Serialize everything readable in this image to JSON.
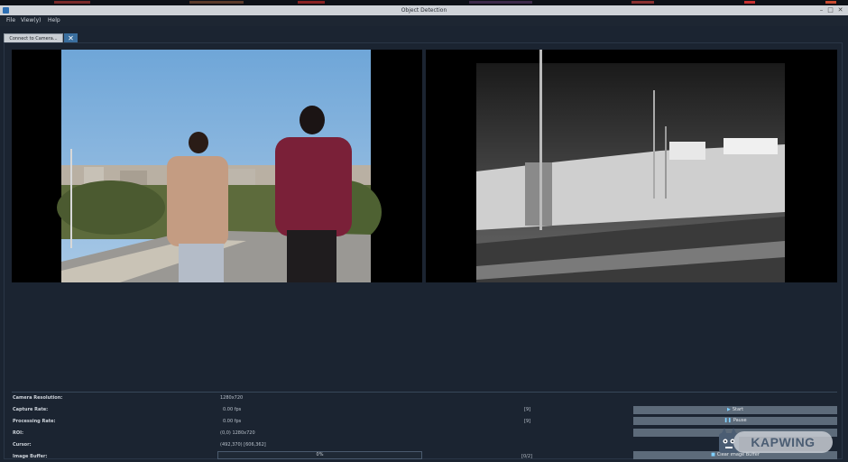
{
  "window": {
    "title": "Object Detection"
  },
  "menu": {
    "items": [
      "File",
      "View(y)",
      "Help"
    ]
  },
  "tab": {
    "label": "Connect to Camera...",
    "close_symbol": "✕"
  },
  "stats": {
    "camera_resolution": {
      "label": "Camera Resolution:",
      "value": "1280x720"
    },
    "capture_rate": {
      "label": "Capture Rate:",
      "value": "0.00 fps",
      "count": "[9]"
    },
    "processing_rate": {
      "label": "Processing Rate:",
      "value": "0.00 fps",
      "count": "[9]"
    },
    "roi": {
      "label": "ROI:",
      "value": "(0,0) 1280x720"
    },
    "cursor": {
      "label": "Cursor:",
      "value": "(492,370) [606,362]"
    },
    "image_buffer": {
      "label": "Image Buffer:",
      "progress": "0%",
      "progress_value": 0,
      "count": "[0/2]"
    }
  },
  "controls": {
    "start_label": "Start",
    "pause_label": "Pause",
    "third_label": "",
    "clear_label": "Clear Image Buffer"
  },
  "watermark": {
    "text": "KAPWING"
  },
  "colors": {
    "bg": "#1b2431",
    "button": "#5d6b7a",
    "accent": "#3a6e9e"
  }
}
